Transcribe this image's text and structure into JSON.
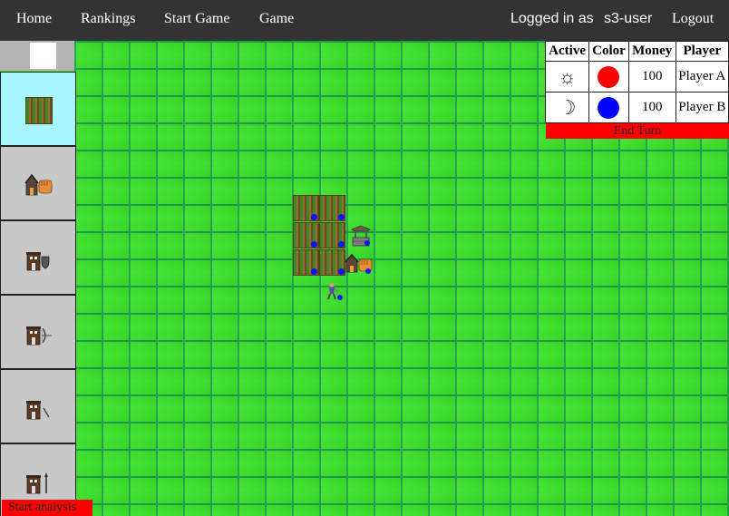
{
  "nav": {
    "home": "Home",
    "rankings": "Rankings",
    "start_game": "Start Game",
    "game": "Game",
    "logged_in_as": "Logged in as",
    "username": "s3-user",
    "logout": "Logout"
  },
  "sidebar": {
    "items": [
      {
        "name": "field",
        "icon": "field-icon",
        "selected": true
      },
      {
        "name": "barracks",
        "icon": "house-fist-icon"
      },
      {
        "name": "shield-unit",
        "icon": "house-shield-icon"
      },
      {
        "name": "archer-unit",
        "icon": "house-bow-icon"
      },
      {
        "name": "swordsman-unit",
        "icon": "house-sword-icon"
      },
      {
        "name": "spearman-unit",
        "icon": "house-spear-icon"
      }
    ],
    "start_analysis": "Start analysis"
  },
  "players_table": {
    "headers": [
      "Active",
      "Color",
      "Money",
      "Player"
    ],
    "rows": [
      {
        "active_icon": "sun-icon",
        "active_symbol": "☼",
        "color": "#ff0000",
        "money": "100",
        "player": "Player A"
      },
      {
        "active_icon": "moon-icon",
        "active_symbol": "☽",
        "color": "#0000ff",
        "money": "100",
        "player": "Player B"
      }
    ],
    "end_turn": "End Turn"
  },
  "board": {
    "units": [
      "field",
      "field",
      "field",
      "field",
      "field",
      "field",
      "well",
      "barracks",
      "worker"
    ],
    "owner_color": "#0a14ff"
  }
}
